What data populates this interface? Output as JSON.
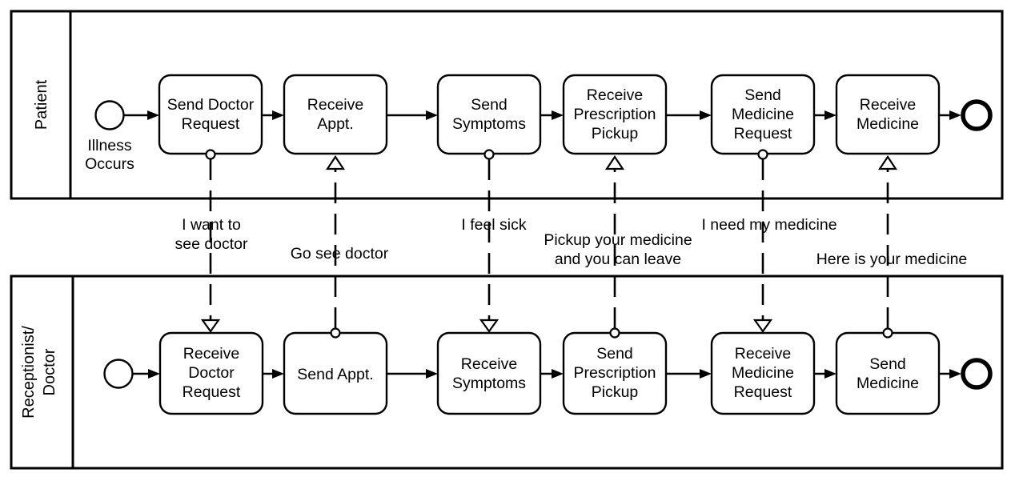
{
  "diagram": {
    "type": "bpmn-collaboration",
    "title": "Patient / Receptionist-Doctor message flow",
    "colors": {
      "stroke": "#000000",
      "fill": "#ffffff"
    }
  },
  "pools": [
    {
      "id": "patient",
      "label": "Patient",
      "start_event": {
        "label": "Illness Occurs"
      },
      "end_event": {
        "label": ""
      },
      "tasks": [
        {
          "id": "p1",
          "label": "Send Doctor\nRequest",
          "lines": [
            "Send Doctor",
            "Request"
          ]
        },
        {
          "id": "p2",
          "label": "Receive\nAppt.",
          "lines": [
            "Receive",
            "Appt."
          ]
        },
        {
          "id": "p3",
          "label": "Send\nSymptoms",
          "lines": [
            "Send",
            "Symptoms"
          ]
        },
        {
          "id": "p4",
          "label": "Receive\nPrescription\nPickup",
          "lines": [
            "Receive",
            "Prescription",
            "Pickup"
          ]
        },
        {
          "id": "p5",
          "label": "Send\nMedicine\nRequest",
          "lines": [
            "Send",
            "Medicine",
            "Request"
          ]
        },
        {
          "id": "p6",
          "label": "Receive\nMedicine",
          "lines": [
            "Receive",
            "Medicine"
          ]
        }
      ]
    },
    {
      "id": "receptionist",
      "label": "Receptionist/\nDoctor",
      "label_lines": [
        "Receptionist/",
        "Doctor"
      ],
      "start_event": {
        "label": ""
      },
      "end_event": {
        "label": ""
      },
      "tasks": [
        {
          "id": "r1",
          "label": "Receive\nDoctor\nRequest",
          "lines": [
            "Receive",
            "Doctor",
            "Request"
          ]
        },
        {
          "id": "r2",
          "label": "Send Appt.",
          "lines": [
            "Send Appt."
          ]
        },
        {
          "id": "r3",
          "label": "Receive\nSymptoms",
          "lines": [
            "Receive",
            "Symptoms"
          ]
        },
        {
          "id": "r4",
          "label": "Send\nPrescription\nPickup",
          "lines": [
            "Send",
            "Prescription",
            "Pickup"
          ]
        },
        {
          "id": "r5",
          "label": "Receive\nMedicine\nRequest",
          "lines": [
            "Receive",
            "Medicine",
            "Request"
          ]
        },
        {
          "id": "r6",
          "label": "Send\nMedicine",
          "lines": [
            "Send",
            "Medicine"
          ]
        }
      ]
    }
  ],
  "message_flows": [
    {
      "id": "m1",
      "from": "p1",
      "to": "r1",
      "direction": "down",
      "label": "I want to\nsee doctor",
      "lines": [
        "I want to",
        "see doctor"
      ]
    },
    {
      "id": "m2",
      "from": "r2",
      "to": "p2",
      "direction": "up",
      "label": "Go see doctor",
      "lines": [
        "Go see doctor"
      ]
    },
    {
      "id": "m3",
      "from": "p3",
      "to": "r3",
      "direction": "down",
      "label": "I feel sick",
      "lines": [
        "I feel sick"
      ]
    },
    {
      "id": "m4",
      "from": "r4",
      "to": "p4",
      "direction": "up",
      "label": "Pickup your medicine\nand you can leave",
      "lines": [
        "Pickup your medicine",
        "and you can leave"
      ]
    },
    {
      "id": "m5",
      "from": "p5",
      "to": "r5",
      "direction": "down",
      "label": "I need my medicine",
      "lines": [
        "I need my medicine"
      ]
    },
    {
      "id": "m6",
      "from": "r6",
      "to": "p6",
      "direction": "up",
      "label": "Here is your medicine",
      "lines": [
        "Here is your medicine"
      ]
    }
  ]
}
